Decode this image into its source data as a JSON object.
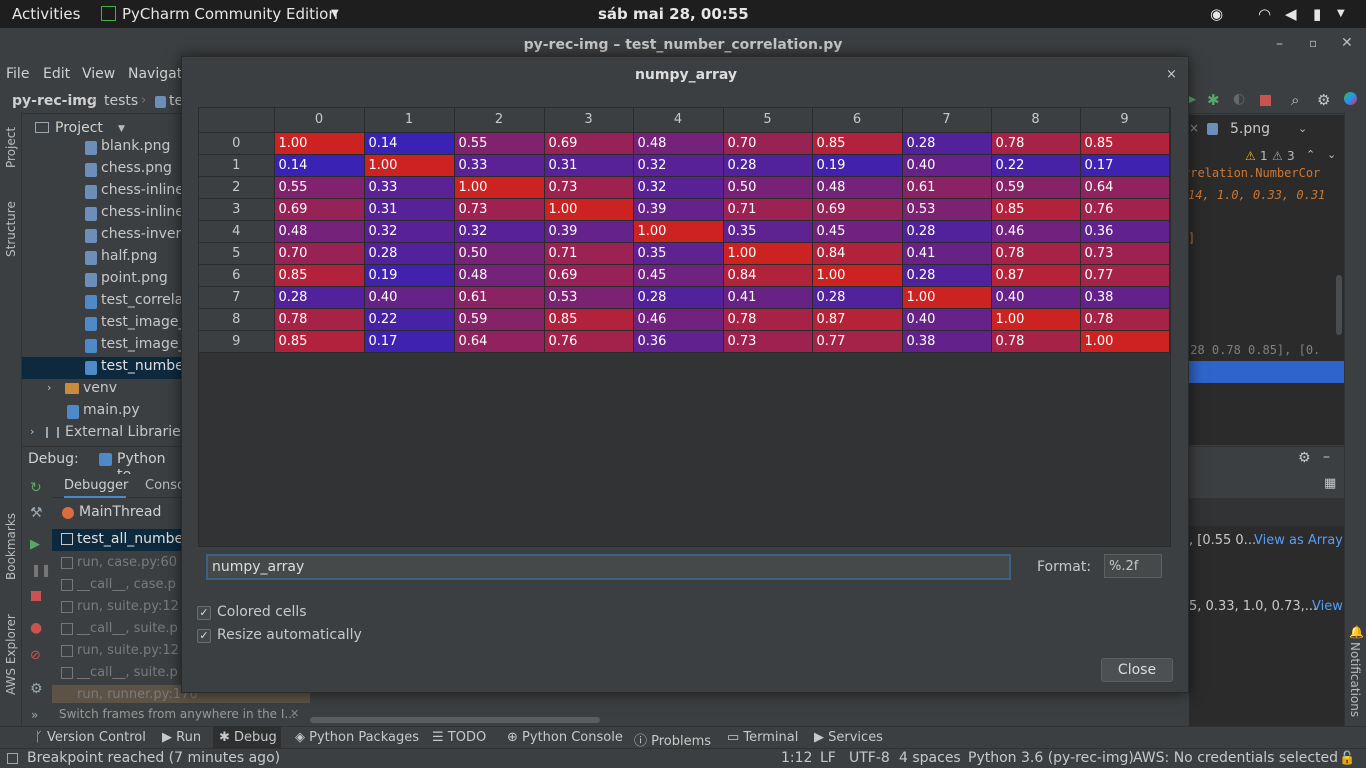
{
  "system_bar": {
    "activities": "Activities",
    "app_name": "PyCharm Community Edition",
    "clock": "sáb mai 28, 00:55"
  },
  "window": {
    "title": "py-rec-img – test_number_correlation.py"
  },
  "menu": [
    "File",
    "Edit",
    "View",
    "Navigat"
  ],
  "breadcrumb": {
    "project": "py-rec-img",
    "folder": "tests",
    "file": "te"
  },
  "project_panel": {
    "title": "Project",
    "items": [
      "blank.png",
      "chess.png",
      "chess-inline.",
      "chess-inline-",
      "chess-invers",
      "half.png",
      "point.png",
      "test_correla",
      "test_image_",
      "test_image_",
      "test_numbe"
    ],
    "venv": "venv",
    "main": "main.py",
    "external": "External Libraries"
  },
  "side_labels": {
    "project": "Project",
    "structure": "Structure",
    "bookmarks": "Bookmarks",
    "aws": "AWS Explorer",
    "notifications": "Notifications"
  },
  "debug": {
    "label": "Debug:",
    "config": "Python te",
    "tab_debugger": "Debugger",
    "tab_console": "Conso",
    "thread": "MainThread",
    "frames": [
      "test_all_numbe",
      "run, case.py:60",
      "__call__, case.p",
      "run, suite.py:12",
      "__call__, suite.p",
      "run, suite.py:12",
      "__call__, suite.p",
      "run, runner.py:176"
    ],
    "hint": "Switch frames from anywhere in the I..."
  },
  "editor_right": {
    "tab": "5.png",
    "warnings": "1",
    "weak_warnings": "3",
    "code1": "rrelation.NumberCor",
    "code2": "14, 1.0, 0.33, 0.31",
    "code3": "]",
    "code4": ".28 0.78 0.85], [0.",
    "var1": ", [0.55 0...",
    "view_as_array": "View as Array",
    "var2": "5, 0.33, 1.0, 0.73,...",
    "view": "View"
  },
  "dialog": {
    "title": "numpy_array",
    "col_headers": [
      "0",
      "1",
      "2",
      "3",
      "4",
      "5",
      "6",
      "7",
      "8",
      "9"
    ],
    "rows": [
      {
        "label": "0",
        "cells": [
          "1.00",
          "0.14",
          "0.55",
          "0.69",
          "0.48",
          "0.70",
          "0.85",
          "0.28",
          "0.78",
          "0.85"
        ]
      },
      {
        "label": "1",
        "cells": [
          "0.14",
          "1.00",
          "0.33",
          "0.31",
          "0.32",
          "0.28",
          "0.19",
          "0.40",
          "0.22",
          "0.17"
        ]
      },
      {
        "label": "2",
        "cells": [
          "0.55",
          "0.33",
          "1.00",
          "0.73",
          "0.32",
          "0.50",
          "0.48",
          "0.61",
          "0.59",
          "0.64"
        ]
      },
      {
        "label": "3",
        "cells": [
          "0.69",
          "0.31",
          "0.73",
          "1.00",
          "0.39",
          "0.71",
          "0.69",
          "0.53",
          "0.85",
          "0.76"
        ]
      },
      {
        "label": "4",
        "cells": [
          "0.48",
          "0.32",
          "0.32",
          "0.39",
          "1.00",
          "0.35",
          "0.45",
          "0.28",
          "0.46",
          "0.36"
        ]
      },
      {
        "label": "5",
        "cells": [
          "0.70",
          "0.28",
          "0.50",
          "0.71",
          "0.35",
          "1.00",
          "0.84",
          "0.41",
          "0.78",
          "0.73"
        ]
      },
      {
        "label": "6",
        "cells": [
          "0.85",
          "0.19",
          "0.48",
          "0.69",
          "0.45",
          "0.84",
          "1.00",
          "0.28",
          "0.87",
          "0.77"
        ]
      },
      {
        "label": "7",
        "cells": [
          "0.28",
          "0.40",
          "0.61",
          "0.53",
          "0.28",
          "0.41",
          "0.28",
          "1.00",
          "0.40",
          "0.38"
        ]
      },
      {
        "label": "8",
        "cells": [
          "0.78",
          "0.22",
          "0.59",
          "0.85",
          "0.46",
          "0.78",
          "0.87",
          "0.40",
          "1.00",
          "0.78"
        ]
      },
      {
        "label": "9",
        "cells": [
          "0.85",
          "0.17",
          "0.64",
          "0.76",
          "0.36",
          "0.73",
          "0.77",
          "0.38",
          "0.78",
          "1.00"
        ]
      }
    ],
    "expression": "numpy_array",
    "format_label": "Format:",
    "format_value": "%.2f",
    "colored_cells": "Colored cells",
    "resize_auto": "Resize automatically",
    "close": "Close"
  },
  "bottom_tabs": [
    "Version Control",
    "Run",
    "Debug",
    "Python Packages",
    "TODO",
    "Python Console",
    "Problems",
    "Terminal",
    "Services"
  ],
  "status": {
    "message": "Breakpoint reached (7 minutes ago)",
    "position": "1:12",
    "line_sep": "LF",
    "encoding": "UTF-8",
    "indent": "4 spaces",
    "interpreter": "Python 3.6 (py-rec-img)",
    "aws": "AWS: No credentials selected"
  },
  "colors": {
    "low": "#2222cc",
    "high": "#cc2222",
    "accent": "#2f65ca",
    "selection": "#0d293e"
  }
}
